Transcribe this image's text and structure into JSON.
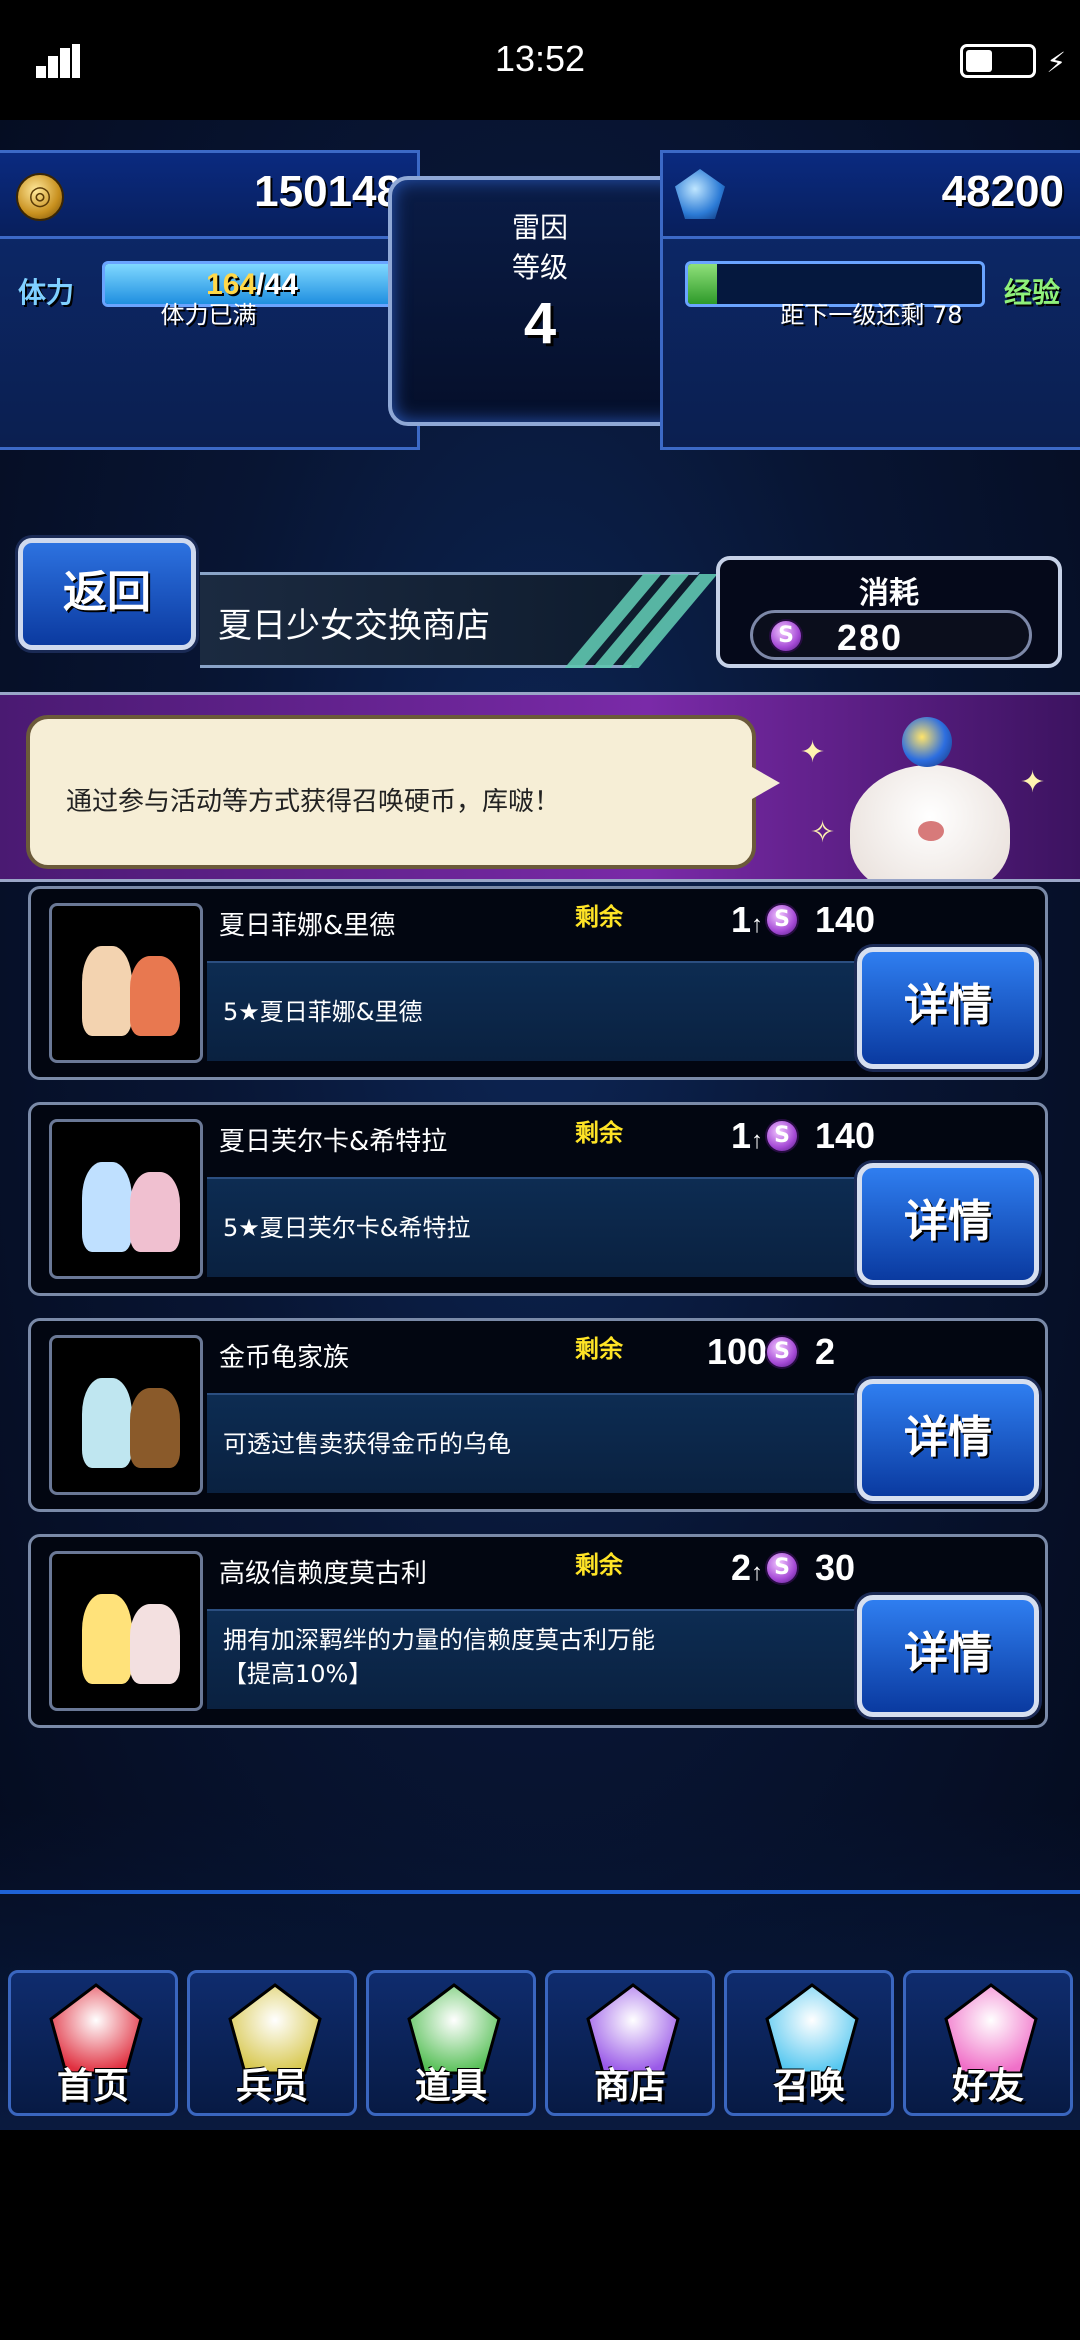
{
  "status_bar": {
    "time": "13:52"
  },
  "hud": {
    "gil": "150148",
    "gems": "48200",
    "player_name": "雷因",
    "level_label": "等级",
    "level": "4",
    "stamina_label": "体力",
    "stamina_current": "164",
    "stamina_max": "/44",
    "stamina_fraction": 1.0,
    "stamina_note": "体力已满",
    "exp_label": "经验",
    "exp_fraction": 0.1,
    "exp_note": "距下一级还剩 78"
  },
  "shop": {
    "back_label": "返回",
    "title": "夏日少女交换商店",
    "cost_label": "消耗",
    "cost_value": "280"
  },
  "banner": {
    "message": "通过参与活动等方式获得召唤硬币，库啵！"
  },
  "items": [
    {
      "name": "夏日菲娜&里德",
      "remain_label": "剩余",
      "qty": "1",
      "price": "140",
      "desc": "5★夏日菲娜&里德",
      "desc2": "",
      "button": "详情"
    },
    {
      "name": "夏日芙尔卡&希特拉",
      "remain_label": "剩余",
      "qty": "1",
      "price": "140",
      "desc": "5★夏日芙尔卡&希特拉",
      "desc2": "",
      "button": "详情"
    },
    {
      "name": "金币龟家族",
      "remain_label": "剩余",
      "qty": "100",
      "price": "2",
      "desc": "可透过售卖获得金币的乌龟",
      "desc2": "",
      "button": "详情"
    },
    {
      "name": "高级信赖度莫古利",
      "remain_label": "剩余",
      "qty": "2",
      "price": "30",
      "desc": "拥有加深羁绊的力量的信赖度莫古利万能",
      "desc2": "【提高10%】",
      "button": "详情"
    }
  ],
  "nav": [
    {
      "label": "首页",
      "icon": "sword-icon",
      "color": "#e03040"
    },
    {
      "label": "兵员",
      "icon": "warrior-icon",
      "color": "#d8c850"
    },
    {
      "label": "道具",
      "icon": "potion-icon",
      "color": "#58c058"
    },
    {
      "label": "商店",
      "icon": "shop-cart-icon",
      "color": "#9a5ae8"
    },
    {
      "label": "召唤",
      "icon": "crystal-icon",
      "color": "#58c8f0"
    },
    {
      "label": "好友",
      "icon": "friends-icon",
      "color": "#f070c8"
    }
  ]
}
